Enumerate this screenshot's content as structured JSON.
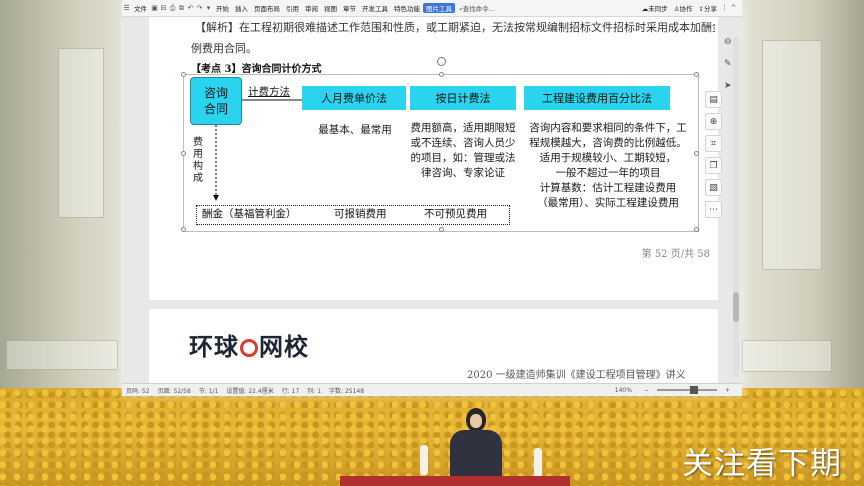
{
  "app": {
    "menu": [
      {
        "label": "文件",
        "icon": "hamburger-icon"
      },
      {
        "label": "开始"
      },
      {
        "label": "插入"
      },
      {
        "label": "页面布局"
      },
      {
        "label": "引用"
      },
      {
        "label": "审阅"
      },
      {
        "label": "视图"
      },
      {
        "label": "章节"
      },
      {
        "label": "开发工具"
      },
      {
        "label": "特色功能"
      },
      {
        "label": "图片工具",
        "active": true
      }
    ],
    "search_label": "查找命令...",
    "right_menu": [
      "未同步",
      "协作",
      "分享"
    ],
    "accent_color": "#3b76d8"
  },
  "document": {
    "top_line": "【解析】在工程初期很难描述工作范围和性质，或工期紧迫，无法按常规编制招标文件招标时采用成本加酬金合",
    "top_line2": "例费用合同。",
    "heading": "【考点 3】咨询合同计价方式",
    "figure": {
      "main_box": "咨询合同",
      "method_label": "计费方法",
      "boxes": [
        "人月费单价法",
        "按日计费法",
        "工程建设费用百分比法"
      ],
      "box_color": "#2ad4ee",
      "notes": [
        [
          "最基本、最常用"
        ],
        [
          "费用额高，适用期限短",
          "或不连续、咨询人员少",
          "的项目，如：管理或法",
          "律咨询、专家论证"
        ],
        [
          "咨询内容和要求相同的条件下，工",
          "程规模越大，咨询费的比例越低。",
          "适用于规模较小、工期较短，",
          "一般不超过一年的项目",
          "计算基数：估计工程建设费用",
          "（最常用）、实际工程建设费用"
        ]
      ],
      "cost_label": "费用构成",
      "cost_items": [
        "酬金（基福管利金）",
        "可报销费用",
        "不可预见费用"
      ]
    },
    "page_footer": "第 52 页/共 58",
    "page2_brand_left": "环球",
    "page2_brand_right": "网校",
    "page2_text": "2020 一级建造师集训《建设工程项目管理》讲义"
  },
  "statusbar": {
    "items": [
      "页码: 52",
      "页面: 52/58",
      "节: 1/1",
      "设置值: 22.4厘米",
      "行: 17",
      "列: 1",
      "字数: 25148"
    ],
    "zoom": "140%",
    "zoom_fraction": 0.55
  },
  "float_tools": [
    "layout-icon",
    "zoom-icon",
    "crop-icon",
    "copy-icon",
    "image-icon",
    "more-icon"
  ],
  "overlay": {
    "caption": "关注看下期"
  }
}
